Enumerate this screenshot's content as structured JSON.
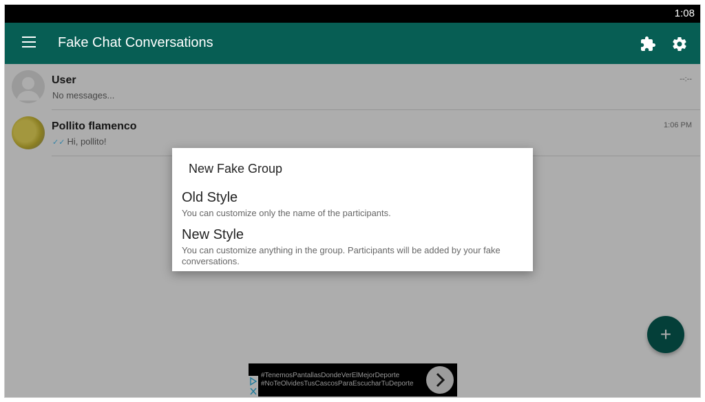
{
  "status_bar": {
    "time": "1:08"
  },
  "app_bar": {
    "title": "Fake Chat Conversations",
    "icons": [
      "menu-icon",
      "puzzle-icon",
      "gear-icon"
    ]
  },
  "conversations": [
    {
      "name": "User",
      "message": "No messages...",
      "time": "--:--",
      "avatar": "default-avatar"
    },
    {
      "name": "Pollito flamenco",
      "message": "Hi, pollito!",
      "time": "1:06 PM",
      "avatar": "chick-avatar",
      "read_receipt": "✓✓"
    }
  ],
  "dialog": {
    "title": "New Fake Group",
    "options": [
      {
        "title": "Old Style",
        "description": "You can customize only the name of the participants."
      },
      {
        "title": "New Style",
        "description": "You can customize anything in the group. Participants will be added by your fake conversations."
      }
    ]
  },
  "fab": {
    "label": "+"
  },
  "ad": {
    "line1": "#TenemosPantallasDondeVerElMejorDeporte",
    "line2": "#NoTeOlvidesTusCascosParaEscucharTuDeporte"
  },
  "colors": {
    "primary": "#075e54",
    "accent": "#4fc3f7"
  }
}
